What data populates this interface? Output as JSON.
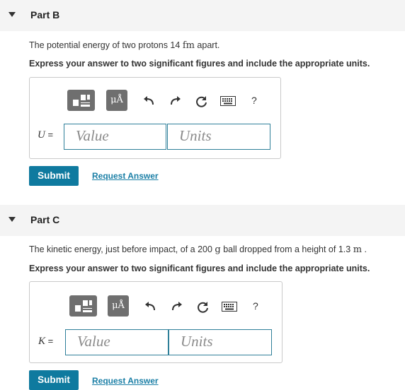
{
  "part_b": {
    "title": "Part B",
    "question_prefix": "The potential energy of two protons 14 ",
    "question_unit": "fm",
    "question_suffix": " apart.",
    "instruction": "Express your answer to two significant figures and include the appropriate units.",
    "toolbar": {
      "mu_label": "μÅ",
      "help_label": "?"
    },
    "variable": "U",
    "equals": "=",
    "value_placeholder": "Value",
    "units_placeholder": "Units",
    "submit_label": "Submit",
    "request_label": "Request Answer"
  },
  "part_c": {
    "title": "Part C",
    "question_prefix": "The kinetic energy, just before impact, of a 200 ",
    "question_unit1": "g",
    "question_mid": " ball dropped from a height of 1.3 ",
    "question_unit2": "m",
    "question_suffix": " .",
    "instruction": "Express your answer to two significant figures and include the appropriate units.",
    "toolbar": {
      "mu_label": "μÅ",
      "help_label": "?"
    },
    "variable": "K",
    "equals": "=",
    "value_placeholder": "Value",
    "units_placeholder": "Units",
    "submit_label": "Submit",
    "request_label": "Request Answer"
  }
}
